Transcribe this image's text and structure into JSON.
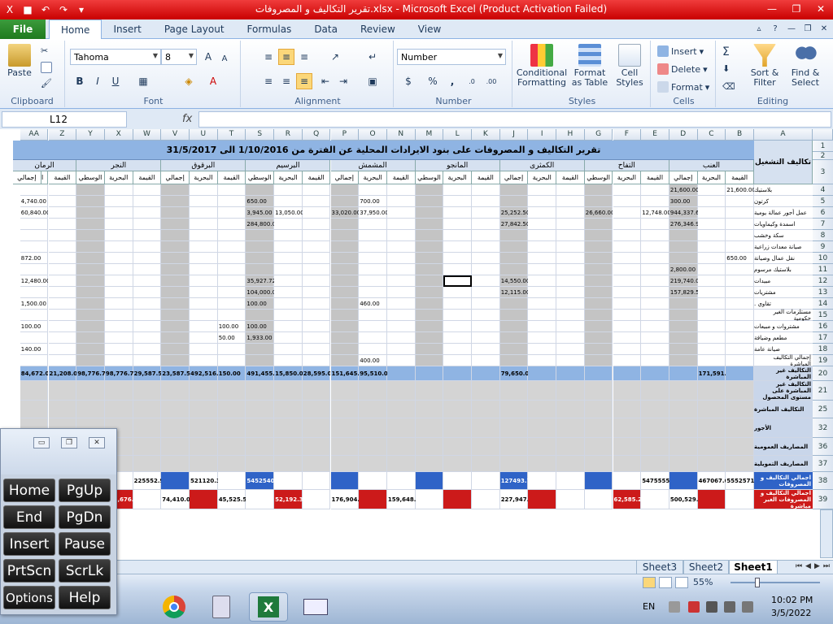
{
  "window": {
    "title": "تقرير التكاليف و المصروفات.xlsx - Microsoft Excel (Product Activation Failed)"
  },
  "ribbon": {
    "file_tab": "File",
    "tabs": [
      "Home",
      "Insert",
      "Page Layout",
      "Formulas",
      "Data",
      "Review",
      "View"
    ],
    "clipboard": {
      "label": "Clipboard",
      "paste": "Paste"
    },
    "font": {
      "label": "Font",
      "name": "Tahoma",
      "size": "8"
    },
    "alignment": {
      "label": "Alignment"
    },
    "number": {
      "label": "Number",
      "format": "Number"
    },
    "styles": {
      "label": "Styles",
      "conditional": "Conditional Formatting",
      "format_table": "Format as Table",
      "cell_styles": "Cell Styles"
    },
    "cells": {
      "label": "Cells",
      "insert": "Insert",
      "delete": "Delete",
      "format": "Format"
    },
    "editing": {
      "label": "Editing",
      "sort": "Sort & Filter",
      "find": "Find & Select"
    }
  },
  "formula_bar": {
    "name_box": "L12",
    "fx": "fx",
    "value": ""
  },
  "grid": {
    "columns": [
      "A",
      "B",
      "C",
      "D",
      "E",
      "F",
      "G",
      "H",
      "I",
      "J",
      "K",
      "L",
      "M",
      "N",
      "O",
      "P",
      "Q",
      "R",
      "S",
      "T",
      "U",
      "V",
      "W",
      "X",
      "Y",
      "Z",
      "AA"
    ],
    "row_numbers": [
      "1",
      "2",
      "3",
      "4",
      "5",
      "6",
      "7",
      "8",
      "9",
      "10",
      "11",
      "12",
      "13",
      "14",
      "15",
      "16",
      "17",
      "18",
      "19",
      "20",
      "21",
      "25",
      "32",
      "36",
      "37",
      "38",
      "39"
    ],
    "banner": "تقرير التكاليف و المصروفات على بنود الايرادات المحلية عن الفترة من 1/10/2016 الى 31/5/2017",
    "header_label": "تكاليف التشغيل",
    "groups": [
      "العنب",
      "التفاح",
      "الكمثرى",
      "المانجو",
      "المشمش",
      "البرسيم",
      "البرقوق",
      "النجر",
      "الرمان"
    ],
    "sub_headers": [
      "القيمة",
      "البحرية",
      "إجمالي",
      "الوسطي"
    ],
    "row_labels": [
      "بلاستيك",
      "كرتون",
      "عمل أجور عمالة يومية",
      "اسمدة وكيماويات",
      "سكة وخشب",
      "صيانة معدات زراعية",
      "نقل عمال وصيانة",
      "بلاستيك مرسوم",
      "مبيدات",
      "مشتريات",
      "تقاوي .",
      "مستلزمات الغير حكومية",
      "مشتروات و مبيعات",
      "مطعم وضيافة",
      "صيانة عامة",
      "إجمالي التكاليف المباشرة",
      "التكاليف غير المباشرة",
      "التكاليف غير المباشرة على مستوى المحصول",
      "التكاليف المباشرة",
      "الأجور",
      "المصاريف العمومية",
      "المصاريف التمويلية",
      "اجمالي التكاليف و المصروفات",
      "اجمالي التكاليف و المصروفات الغير مباشرة"
    ],
    "sample_values": {
      "r4": [
        "21,600.00",
        "21,600.00"
      ],
      "r5": [
        "300.00",
        "700.00",
        "650.00",
        "4,740.00"
      ],
      "r6": [
        "944,337.68",
        "12,748.00",
        "26,660.00",
        "25,252.50",
        "37,950.00",
        "33,020.00",
        "13,050.00",
        "3,945.00",
        "60,840.00"
      ],
      "r7": [
        "276,346.90",
        "27,842.50",
        "284,800.0"
      ],
      "r10": [
        "650.00",
        "872.00"
      ],
      "r11": [
        "2,800.00"
      ],
      "r12": [
        "219,740.00",
        "14,550.00",
        "35,927.72",
        "12,480.00"
      ],
      "r13": [
        "157,829.51",
        "12,115.00",
        "104,000.0"
      ],
      "r14": [
        "460.00",
        "100.00",
        "1,500.00"
      ],
      "r16": [
        "100.00",
        "100.00",
        "100.00"
      ],
      "r17": [
        "50.00",
        "1,933.00"
      ],
      "r18": [
        "140.00"
      ],
      "r19": [
        "400.00"
      ],
      "r20": [
        "171,591.50",
        "79,650.00",
        "95,510.00",
        "151,645.72",
        "98,776.75",
        "98,776.75",
        "29,587.58",
        "23,587.58",
        "492,516.70",
        "150.00",
        "491,455.72",
        "15,850.00",
        "28,595.00",
        "84,672.00",
        "21,208.00"
      ],
      "r38": [
        "5552571.87",
        "467067.64",
        "5475555.60",
        "127493.79",
        "5452540.86",
        "521120.36",
        "225552.93"
      ],
      "r39": [
        "500,529.14",
        "227,947.00",
        "176,904.17",
        "159,648.32",
        "62,585.21",
        "52,192.36",
        "45,525.58",
        "74,410.00",
        "188,676.59"
      ]
    }
  },
  "sheets": [
    "Sheet3",
    "Sheet2",
    "Sheet1"
  ],
  "active_sheet": "Sheet1",
  "status": {
    "zoom": "55%"
  },
  "taskbar": {
    "lang": "EN",
    "time": "10:02 PM",
    "date": "3/5/2022"
  },
  "osk": {
    "keys": [
      "Home",
      "PgUp",
      "End",
      "PgDn",
      "Insert",
      "Pause",
      "PrtScn",
      "ScrLk",
      "Options",
      "Help"
    ]
  },
  "colors": {
    "title_red": "#d90a0a",
    "file_green": "#2a8a2a",
    "banner_blue": "#8fb4e3",
    "total_red": "#cc1a1a",
    "total_blue": "#2f63c7"
  }
}
